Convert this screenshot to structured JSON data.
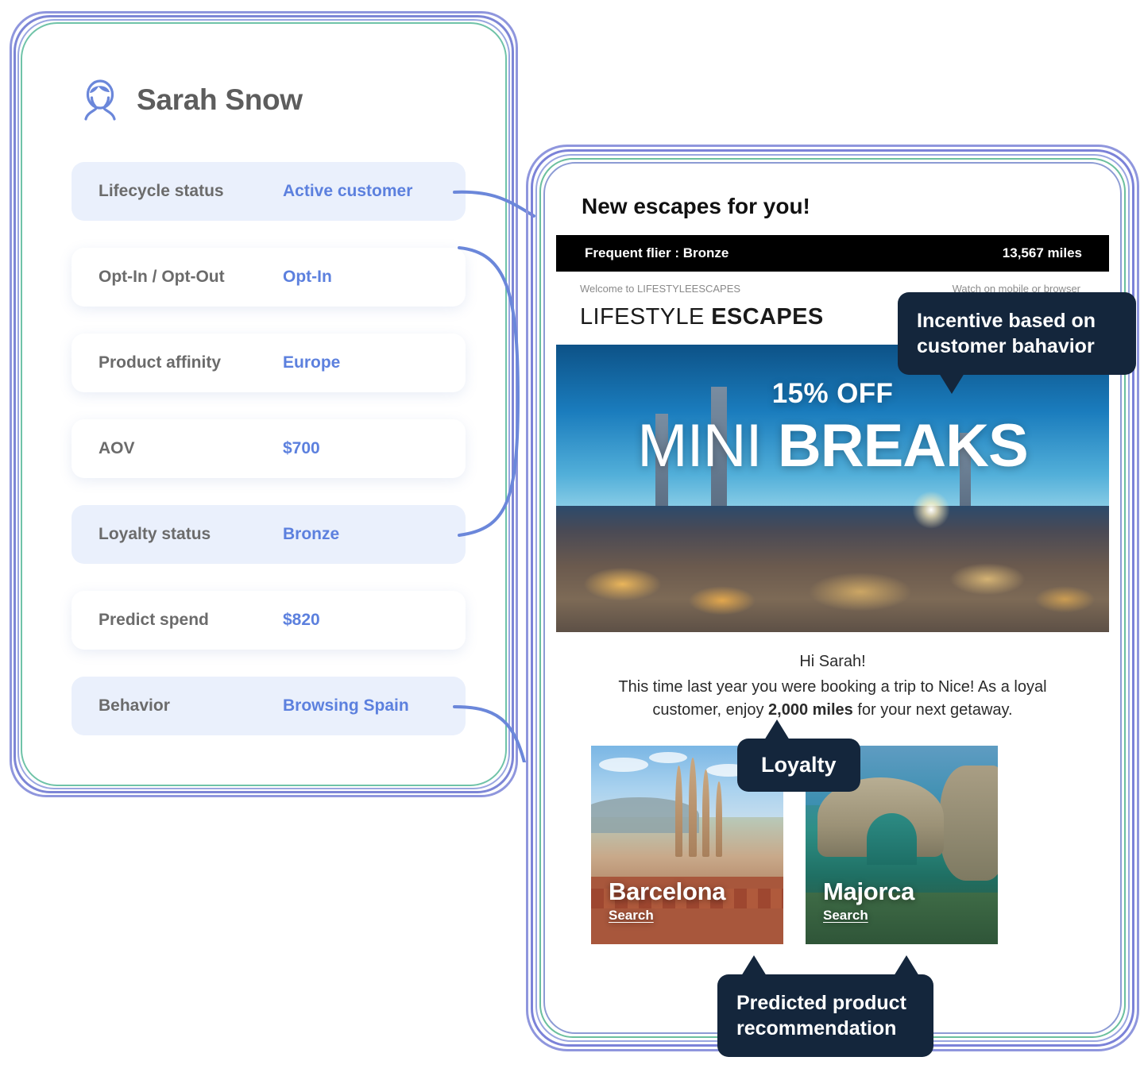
{
  "profile": {
    "avatar_icon": "user-avatar-icon",
    "name": "Sarah Snow",
    "attributes": [
      {
        "label": "Lifecycle status",
        "value": "Active customer",
        "shaded": true
      },
      {
        "label": "Opt-In / Opt-Out",
        "value": "Opt-In",
        "shaded": false
      },
      {
        "label": "Product affinity",
        "value": "Europe",
        "shaded": false
      },
      {
        "label": "AOV",
        "value": "$700",
        "shaded": false
      },
      {
        "label": "Loyalty status",
        "value": "Bronze",
        "shaded": true
      },
      {
        "label": "Predict spend",
        "value": "$820",
        "shaded": false
      },
      {
        "label": "Behavior",
        "value": "Browsing Spain",
        "shaded": true
      }
    ]
  },
  "email": {
    "subject": "New escapes for you!",
    "flier_bar": {
      "tier_label": "Frequent flier : Bronze",
      "miles": "13,567 miles"
    },
    "utility": {
      "welcome": "Welcome to LIFESTYLEESCAPES",
      "view_options": "Watch on mobile or browser"
    },
    "logo": {
      "thin": "LIFESTYLE",
      "bold": "ESCAPES"
    },
    "hero": {
      "discount": "15% OFF",
      "title_thin": "MINI",
      "title_bold": "BREAKS"
    },
    "message": {
      "greeting": "Hi Sarah!",
      "line_before": "This time last year you were booking a trip to Nice! As a loyal customer, enjoy ",
      "highlight": "2,000 miles",
      "line_after": " for your next getaway."
    },
    "destinations": [
      {
        "name": "Barcelona",
        "cta": "Search"
      },
      {
        "name": "Majorca",
        "cta": "Search"
      }
    ]
  },
  "callouts": {
    "incentive": "Incentive based on customer bahavior",
    "loyalty": "Loyalty",
    "prediction": "Predicted product recommendation"
  },
  "colors": {
    "accent_blue": "#5c80de",
    "label_gray": "#6b6b6b",
    "row_shaded": "#eaf0fc",
    "callout_navy": "#14263c",
    "ring_periwinkle": "#7b82d8",
    "ring_slate": "#8c9bd4",
    "ring_teal": "#6bbf9e"
  }
}
